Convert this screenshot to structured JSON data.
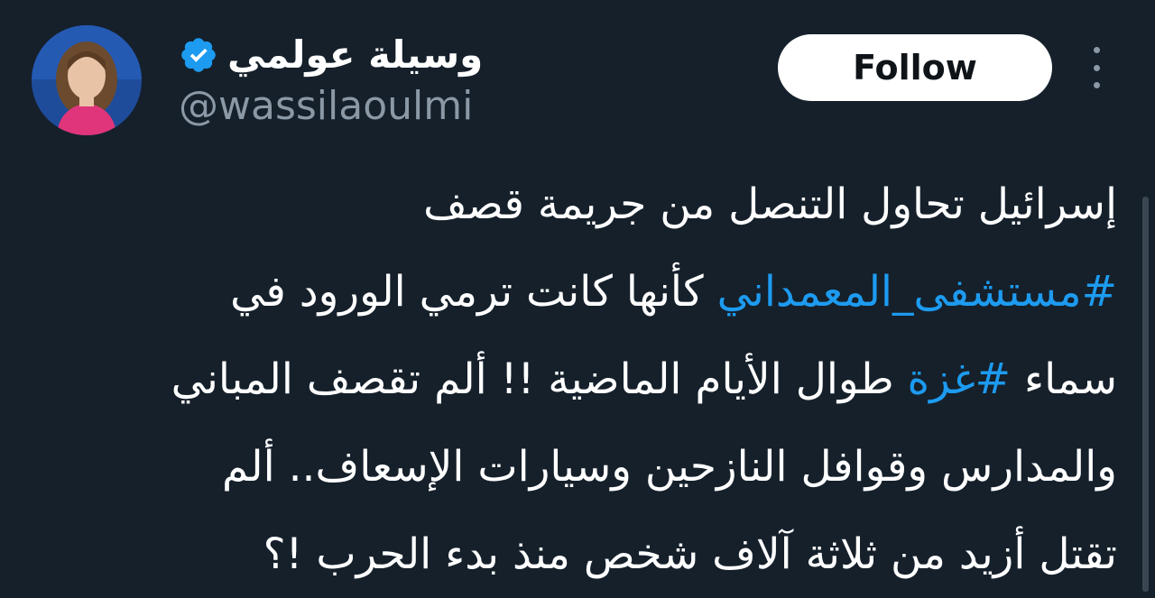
{
  "author": {
    "display_name": "وسيلة عولمي",
    "handle": "@wassilaoulmi",
    "verified_icon": "verified-badge",
    "avatar_icon": "profile-photo"
  },
  "actions": {
    "follow_label": "Follow",
    "more_icon": "more-vertical"
  },
  "tweet": {
    "line1": "إسرائيل تحاول التنصل من جريمة قصف",
    "line2_hashtag": "#مستشفى_المعمداني",
    "line2_text": " كأنها كانت ترمي الورود في",
    "line3_start": "سماء ",
    "line3_hashtag": "#غزة",
    "line3_text": " طوال  الأيام الماضية !! ألم تقصف المباني",
    "line4": "والمدارس وقوافل النازحين وسيارات الإسعاف.. ألم",
    "line5": "تقتل أزيد من ثلاثة آلاف شخص منذ بدء الحرب  !؟"
  },
  "colors": {
    "background": "#15202b",
    "hashtag": "#1d9bf0",
    "verified": "#1d9bf0",
    "secondary_text": "#8b98a5"
  }
}
